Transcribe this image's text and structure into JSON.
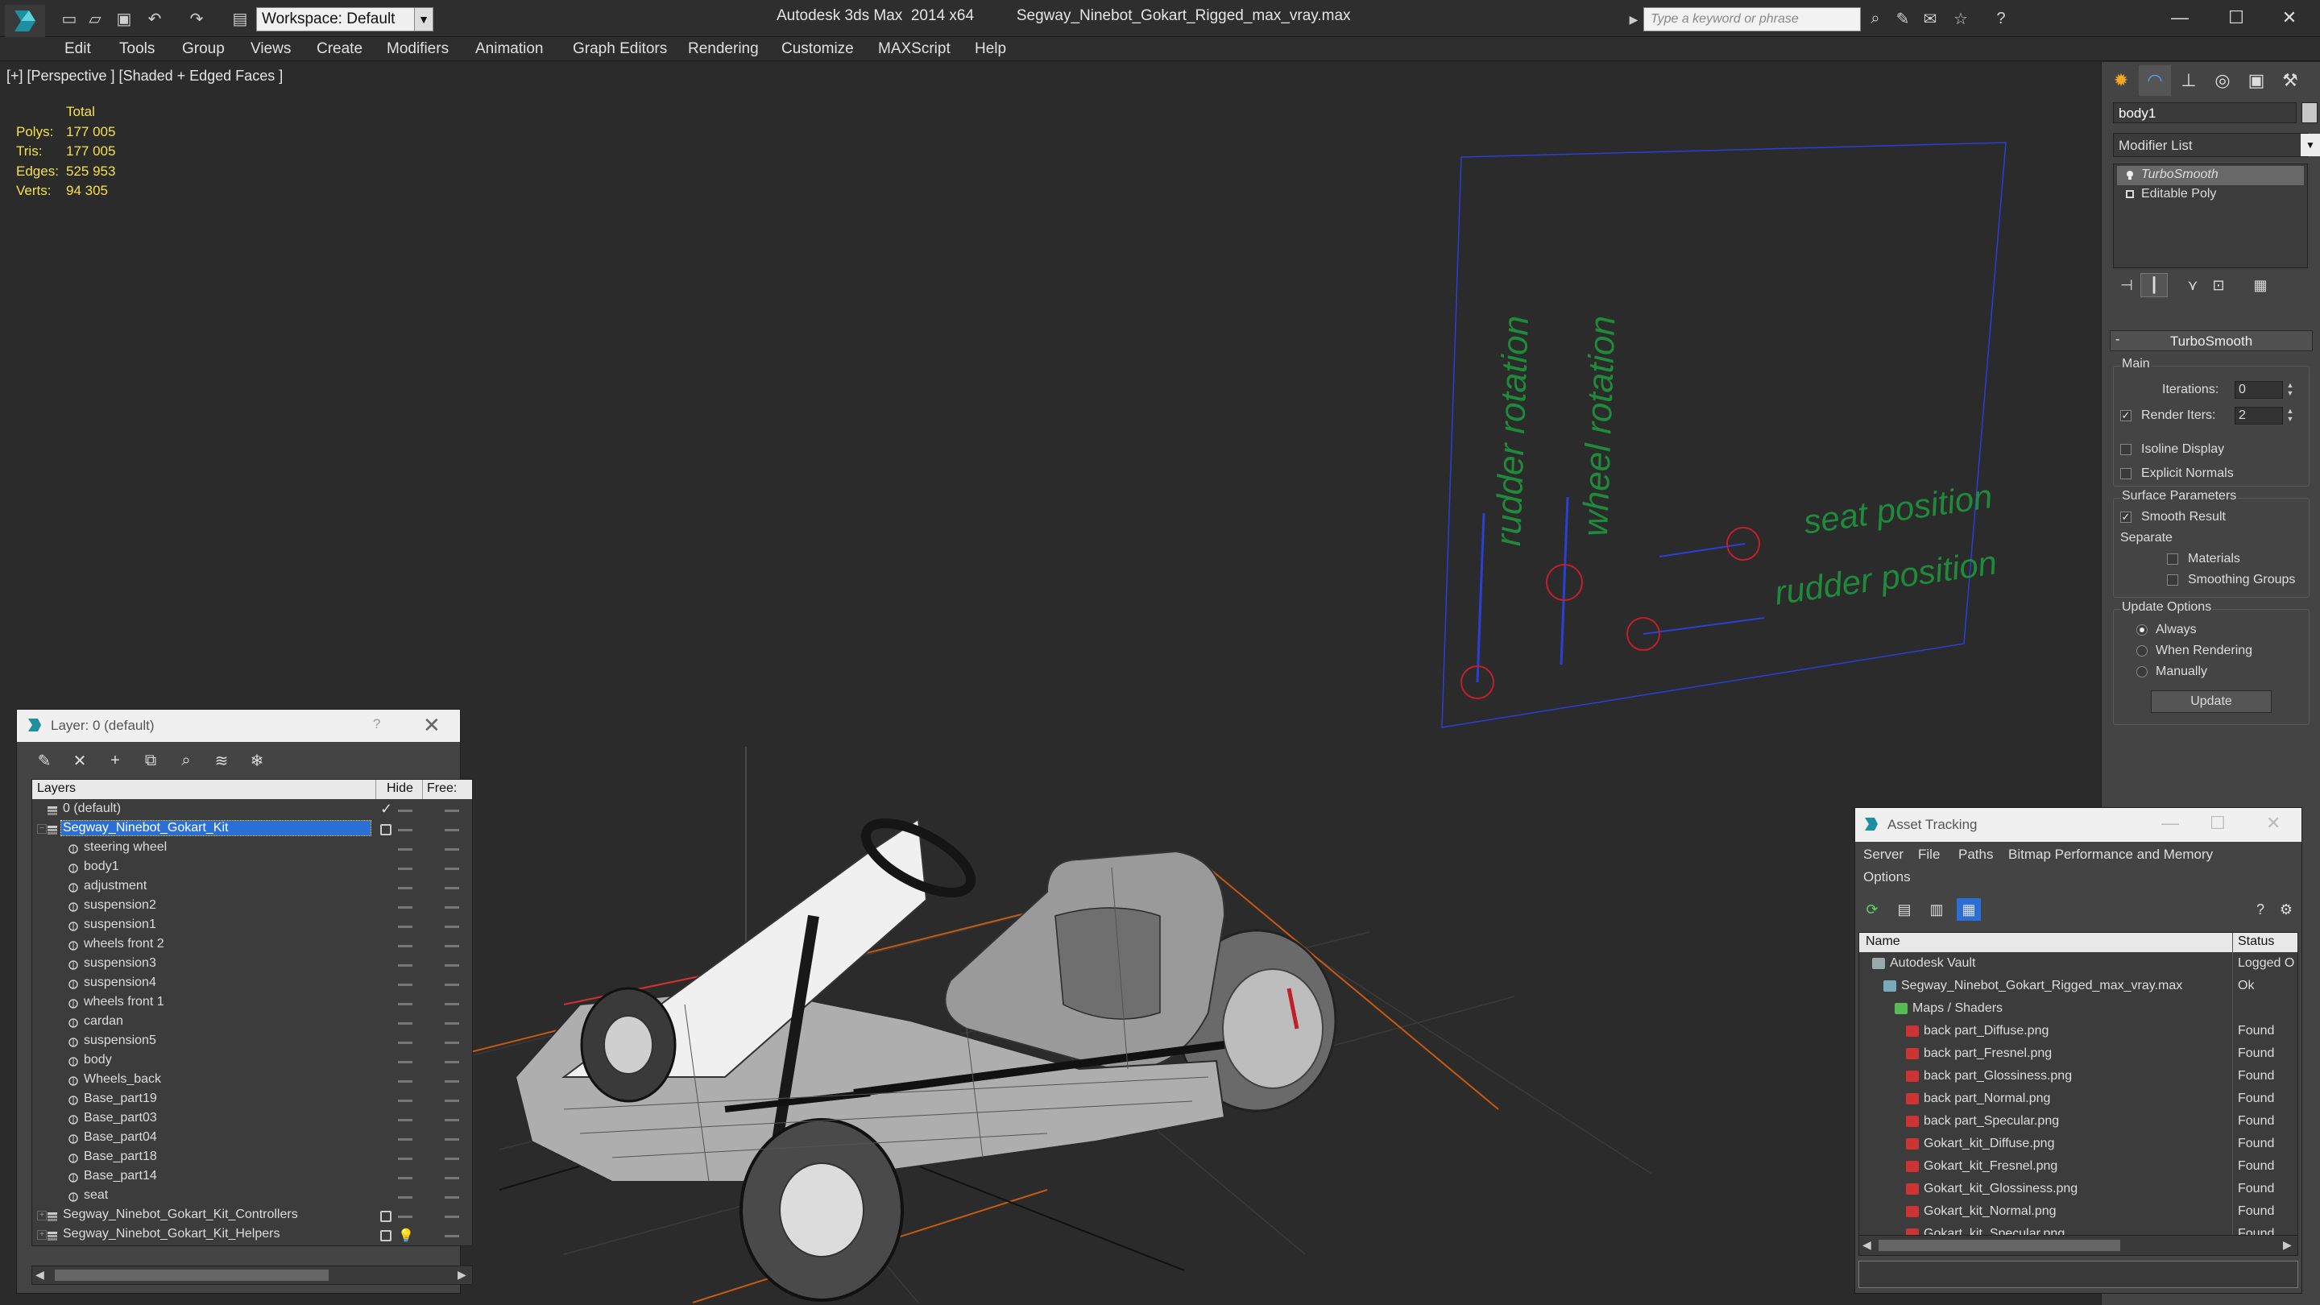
{
  "titlebar": {
    "workspace": "Workspace: Default",
    "app_title": "Autodesk 3ds Max  2014 x64",
    "file_title": "Segway_Ninebot_Gokart_Rigged_max_vray.max",
    "search_placeholder": "Type a keyword or phrase"
  },
  "menu": [
    "Edit",
    "Tools",
    "Group",
    "Views",
    "Create",
    "Modifiers",
    "Animation",
    "Graph Editors",
    "Rendering",
    "Customize",
    "MAXScript",
    "Help"
  ],
  "viewport": {
    "label": "[+] [Perspective ] [Shaded + Edged Faces ]",
    "stats": {
      "header": "Total",
      "rows": [
        {
          "k": "Polys:",
          "v": "177 005"
        },
        {
          "k": "Tris:",
          "v": "177 005"
        },
        {
          "k": "Edges:",
          "v": "525 953"
        },
        {
          "k": "Verts:",
          "v": "94 305"
        }
      ]
    },
    "rig_labels": {
      "rudder_rotation": "rudder rotation",
      "wheel_rotation": "wheel rotation",
      "seat_position": "seat position",
      "rudder_position": "rudder position"
    }
  },
  "command_panel": {
    "object_name": "body1",
    "modifier_list": "Modifier List",
    "stack": [
      "TurboSmooth",
      "Editable Poly"
    ],
    "rollout_title": "TurboSmooth",
    "main_group": "Main",
    "iterations_label": "Iterations:",
    "iterations_value": "0",
    "render_iters_label": "Render Iters:",
    "render_iters_value": "2",
    "isoline": "Isoline Display",
    "explicit_normals": "Explicit Normals",
    "surface_group": "Surface Parameters",
    "smooth_result": "Smooth Result",
    "separate": "Separate",
    "materials": "Materials",
    "smoothing_groups": "Smoothing Groups",
    "update_group": "Update Options",
    "always": "Always",
    "when_rendering": "When Rendering",
    "manually": "Manually",
    "update_btn": "Update"
  },
  "layer_dialog": {
    "title": "Layer: 0 (default)",
    "help": "?",
    "col_layers": "Layers",
    "col_hide": "Hide",
    "col_freeze": "Free:",
    "rows": [
      {
        "name": "0 (default)",
        "level": 0,
        "type": "layer",
        "mark": "check"
      },
      {
        "name": "Segway_Ninebot_Gokart_Kit",
        "level": 0,
        "type": "layer",
        "mark": "box",
        "selected": true
      },
      {
        "name": "steering wheel",
        "level": 1,
        "type": "obj"
      },
      {
        "name": "body1",
        "level": 1,
        "type": "obj"
      },
      {
        "name": "adjustment",
        "level": 1,
        "type": "obj"
      },
      {
        "name": "suspension2",
        "level": 1,
        "type": "obj"
      },
      {
        "name": "suspension1",
        "level": 1,
        "type": "obj"
      },
      {
        "name": "wheels front 2",
        "level": 1,
        "type": "obj"
      },
      {
        "name": "suspension3",
        "level": 1,
        "type": "obj"
      },
      {
        "name": "suspension4",
        "level": 1,
        "type": "obj"
      },
      {
        "name": "wheels front 1",
        "level": 1,
        "type": "obj"
      },
      {
        "name": "cardan",
        "level": 1,
        "type": "obj"
      },
      {
        "name": "suspension5",
        "level": 1,
        "type": "obj"
      },
      {
        "name": "body",
        "level": 1,
        "type": "obj"
      },
      {
        "name": "Wheels_back",
        "level": 1,
        "type": "obj"
      },
      {
        "name": "Base_part19",
        "level": 1,
        "type": "obj"
      },
      {
        "name": "Base_part03",
        "level": 1,
        "type": "obj"
      },
      {
        "name": "Base_part04",
        "level": 1,
        "type": "obj"
      },
      {
        "name": "Base_part18",
        "level": 1,
        "type": "obj"
      },
      {
        "name": "Base_part14",
        "level": 1,
        "type": "obj"
      },
      {
        "name": "seat",
        "level": 1,
        "type": "obj"
      },
      {
        "name": "Segway_Ninebot_Gokart_Kit_Controllers",
        "level": 0,
        "type": "layer",
        "mark": "box",
        "expand": true
      },
      {
        "name": "Segway_Ninebot_Gokart_Kit_Helpers",
        "level": 0,
        "type": "layer",
        "mark": "box",
        "expand": true,
        "bulb": true
      }
    ]
  },
  "asset_dialog": {
    "title": "Asset Tracking",
    "menu": [
      "Server",
      "File",
      "Paths",
      "Bitmap Performance and Memory",
      "Options"
    ],
    "col_name": "Name",
    "col_status": "Status",
    "rows": [
      {
        "name": "Autodesk Vault",
        "status": "Logged O",
        "level": 0,
        "type": "vault"
      },
      {
        "name": "Segway_Ninebot_Gokart_Rigged_max_vray.max",
        "status": "Ok",
        "level": 1,
        "type": "max"
      },
      {
        "name": "Maps / Shaders",
        "status": "",
        "level": 2,
        "type": "maps"
      },
      {
        "name": "back part_Diffuse.png",
        "status": "Found",
        "level": 3,
        "type": "png"
      },
      {
        "name": "back part_Fresnel.png",
        "status": "Found",
        "level": 3,
        "type": "png"
      },
      {
        "name": "back part_Glossiness.png",
        "status": "Found",
        "level": 3,
        "type": "png"
      },
      {
        "name": "back part_Normal.png",
        "status": "Found",
        "level": 3,
        "type": "png"
      },
      {
        "name": "back part_Specular.png",
        "status": "Found",
        "level": 3,
        "type": "png"
      },
      {
        "name": "Gokart_kit_Diffuse.png",
        "status": "Found",
        "level": 3,
        "type": "png"
      },
      {
        "name": "Gokart_kit_Fresnel.png",
        "status": "Found",
        "level": 3,
        "type": "png"
      },
      {
        "name": "Gokart_kit_Glossiness.png",
        "status": "Found",
        "level": 3,
        "type": "png"
      },
      {
        "name": "Gokart_kit_Normal.png",
        "status": "Found",
        "level": 3,
        "type": "png"
      },
      {
        "name": "Gokart_kit_Specular.png",
        "status": "Found",
        "level": 3,
        "type": "png"
      }
    ]
  },
  "colors": {
    "rig_text": "#1f8a3a",
    "rig_line": "#2a3fd6",
    "rig_circle": "#c0202a",
    "stats": "#f4e04d",
    "selection": "#2b6fd6",
    "grid_orange": "#c55a16"
  }
}
